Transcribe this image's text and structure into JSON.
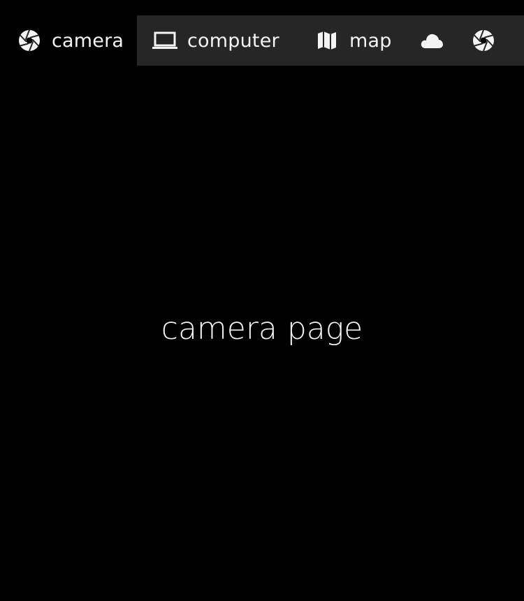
{
  "tabs": [
    {
      "label": "camera",
      "icon": "camera-icon",
      "selected": true
    },
    {
      "label": "computer",
      "icon": "laptop-icon",
      "selected": false
    },
    {
      "label": "map",
      "icon": "map-icon",
      "selected": false
    },
    {
      "label": "",
      "icon": "cloud-icon",
      "selected": false
    },
    {
      "label": "",
      "icon": "camera-icon",
      "selected": false
    }
  ],
  "main": {
    "title": "camera page"
  },
  "colors": {
    "background": "#000000",
    "tabbar": "#262626",
    "text": "#f4f4f4"
  }
}
